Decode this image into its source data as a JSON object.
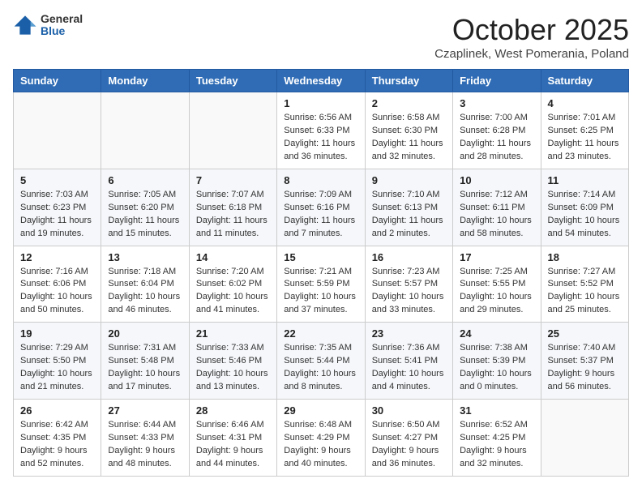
{
  "logo": {
    "general": "General",
    "blue": "Blue"
  },
  "header": {
    "title": "October 2025",
    "subtitle": "Czaplinek, West Pomerania, Poland"
  },
  "weekdays": [
    "Sunday",
    "Monday",
    "Tuesday",
    "Wednesday",
    "Thursday",
    "Friday",
    "Saturday"
  ],
  "weeks": [
    [
      {
        "day": "",
        "info": ""
      },
      {
        "day": "",
        "info": ""
      },
      {
        "day": "",
        "info": ""
      },
      {
        "day": "1",
        "info": "Sunrise: 6:56 AM\nSunset: 6:33 PM\nDaylight: 11 hours\nand 36 minutes."
      },
      {
        "day": "2",
        "info": "Sunrise: 6:58 AM\nSunset: 6:30 PM\nDaylight: 11 hours\nand 32 minutes."
      },
      {
        "day": "3",
        "info": "Sunrise: 7:00 AM\nSunset: 6:28 PM\nDaylight: 11 hours\nand 28 minutes."
      },
      {
        "day": "4",
        "info": "Sunrise: 7:01 AM\nSunset: 6:25 PM\nDaylight: 11 hours\nand 23 minutes."
      }
    ],
    [
      {
        "day": "5",
        "info": "Sunrise: 7:03 AM\nSunset: 6:23 PM\nDaylight: 11 hours\nand 19 minutes."
      },
      {
        "day": "6",
        "info": "Sunrise: 7:05 AM\nSunset: 6:20 PM\nDaylight: 11 hours\nand 15 minutes."
      },
      {
        "day": "7",
        "info": "Sunrise: 7:07 AM\nSunset: 6:18 PM\nDaylight: 11 hours\nand 11 minutes."
      },
      {
        "day": "8",
        "info": "Sunrise: 7:09 AM\nSunset: 6:16 PM\nDaylight: 11 hours\nand 7 minutes."
      },
      {
        "day": "9",
        "info": "Sunrise: 7:10 AM\nSunset: 6:13 PM\nDaylight: 11 hours\nand 2 minutes."
      },
      {
        "day": "10",
        "info": "Sunrise: 7:12 AM\nSunset: 6:11 PM\nDaylight: 10 hours\nand 58 minutes."
      },
      {
        "day": "11",
        "info": "Sunrise: 7:14 AM\nSunset: 6:09 PM\nDaylight: 10 hours\nand 54 minutes."
      }
    ],
    [
      {
        "day": "12",
        "info": "Sunrise: 7:16 AM\nSunset: 6:06 PM\nDaylight: 10 hours\nand 50 minutes."
      },
      {
        "day": "13",
        "info": "Sunrise: 7:18 AM\nSunset: 6:04 PM\nDaylight: 10 hours\nand 46 minutes."
      },
      {
        "day": "14",
        "info": "Sunrise: 7:20 AM\nSunset: 6:02 PM\nDaylight: 10 hours\nand 41 minutes."
      },
      {
        "day": "15",
        "info": "Sunrise: 7:21 AM\nSunset: 5:59 PM\nDaylight: 10 hours\nand 37 minutes."
      },
      {
        "day": "16",
        "info": "Sunrise: 7:23 AM\nSunset: 5:57 PM\nDaylight: 10 hours\nand 33 minutes."
      },
      {
        "day": "17",
        "info": "Sunrise: 7:25 AM\nSunset: 5:55 PM\nDaylight: 10 hours\nand 29 minutes."
      },
      {
        "day": "18",
        "info": "Sunrise: 7:27 AM\nSunset: 5:52 PM\nDaylight: 10 hours\nand 25 minutes."
      }
    ],
    [
      {
        "day": "19",
        "info": "Sunrise: 7:29 AM\nSunset: 5:50 PM\nDaylight: 10 hours\nand 21 minutes."
      },
      {
        "day": "20",
        "info": "Sunrise: 7:31 AM\nSunset: 5:48 PM\nDaylight: 10 hours\nand 17 minutes."
      },
      {
        "day": "21",
        "info": "Sunrise: 7:33 AM\nSunset: 5:46 PM\nDaylight: 10 hours\nand 13 minutes."
      },
      {
        "day": "22",
        "info": "Sunrise: 7:35 AM\nSunset: 5:44 PM\nDaylight: 10 hours\nand 8 minutes."
      },
      {
        "day": "23",
        "info": "Sunrise: 7:36 AM\nSunset: 5:41 PM\nDaylight: 10 hours\nand 4 minutes."
      },
      {
        "day": "24",
        "info": "Sunrise: 7:38 AM\nSunset: 5:39 PM\nDaylight: 10 hours\nand 0 minutes."
      },
      {
        "day": "25",
        "info": "Sunrise: 7:40 AM\nSunset: 5:37 PM\nDaylight: 9 hours\nand 56 minutes."
      }
    ],
    [
      {
        "day": "26",
        "info": "Sunrise: 6:42 AM\nSunset: 4:35 PM\nDaylight: 9 hours\nand 52 minutes."
      },
      {
        "day": "27",
        "info": "Sunrise: 6:44 AM\nSunset: 4:33 PM\nDaylight: 9 hours\nand 48 minutes."
      },
      {
        "day": "28",
        "info": "Sunrise: 6:46 AM\nSunset: 4:31 PM\nDaylight: 9 hours\nand 44 minutes."
      },
      {
        "day": "29",
        "info": "Sunrise: 6:48 AM\nSunset: 4:29 PM\nDaylight: 9 hours\nand 40 minutes."
      },
      {
        "day": "30",
        "info": "Sunrise: 6:50 AM\nSunset: 4:27 PM\nDaylight: 9 hours\nand 36 minutes."
      },
      {
        "day": "31",
        "info": "Sunrise: 6:52 AM\nSunset: 4:25 PM\nDaylight: 9 hours\nand 32 minutes."
      },
      {
        "day": "",
        "info": ""
      }
    ]
  ]
}
